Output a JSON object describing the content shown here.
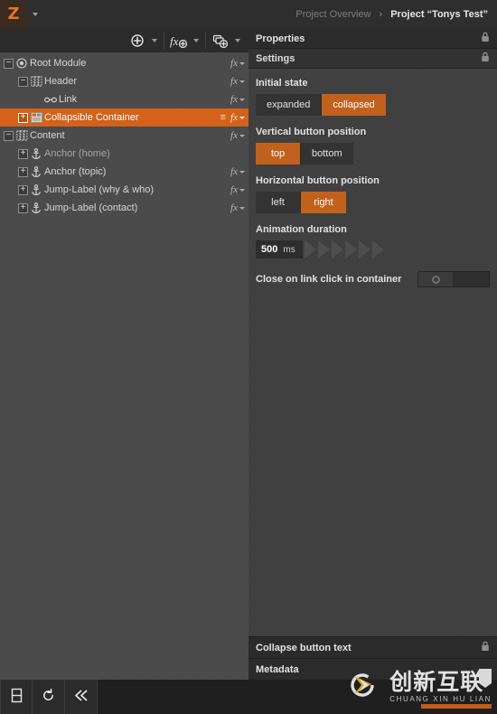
{
  "app": {
    "logo_glyph": "Z",
    "logo_name": "app-logo"
  },
  "breadcrumb": {
    "parent": "Project Overview",
    "separator": "›",
    "current": "Project “Tonys Test”"
  },
  "tree_toolbar": {
    "buttons": [
      {
        "name": "add-element-button",
        "glyph": "⊕",
        "caret": true
      },
      {
        "name": "add-function-button",
        "glyph": "fx",
        "caret": true
      },
      {
        "name": "add-module-button",
        "glyph": "⧉",
        "caret": true
      }
    ]
  },
  "tree": {
    "rows": [
      {
        "label": "Root Module",
        "indent": 0,
        "expander": "−",
        "icon": "target-icon",
        "selected": false,
        "dim": false,
        "fx": true,
        "hamburger": false
      },
      {
        "label": "Header",
        "indent": 1,
        "expander": "−",
        "icon": "container-icon",
        "selected": false,
        "dim": false,
        "fx": true,
        "hamburger": false
      },
      {
        "label": "Link",
        "indent": 2,
        "expander": "",
        "icon": "link-icon",
        "selected": false,
        "dim": false,
        "fx": true,
        "hamburger": false
      },
      {
        "label": "Collapsible Container",
        "indent": 1,
        "expander": "+",
        "icon": "module-icon",
        "selected": true,
        "dim": false,
        "fx": true,
        "hamburger": true
      },
      {
        "label": "Content",
        "indent": 0,
        "expander": "−",
        "icon": "container-icon",
        "selected": false,
        "dim": false,
        "fx": true,
        "hamburger": false
      },
      {
        "label": "Anchor (home)",
        "indent": 1,
        "expander": "+",
        "icon": "anchor-icon",
        "selected": false,
        "dim": true,
        "fx": false,
        "hamburger": false
      },
      {
        "label": "Anchor (topic)",
        "indent": 1,
        "expander": "+",
        "icon": "anchor-icon",
        "selected": false,
        "dim": false,
        "fx": true,
        "hamburger": false
      },
      {
        "label": "Jump-Label (why & who)",
        "indent": 1,
        "expander": "+",
        "icon": "anchor-icon",
        "selected": false,
        "dim": false,
        "fx": true,
        "hamburger": false
      },
      {
        "label": "Jump-Label (contact)",
        "indent": 1,
        "expander": "+",
        "icon": "anchor-icon",
        "selected": false,
        "dim": false,
        "fx": true,
        "hamburger": false
      }
    ],
    "fx_label": "fx",
    "hamburger_glyph": "≡"
  },
  "properties": {
    "header": "Properties",
    "settings_header": "Settings",
    "initial_state": {
      "label": "Initial state",
      "options": [
        "expanded",
        "collapsed"
      ],
      "selected": "collapsed"
    },
    "vertical_position": {
      "label": "Vertical button position",
      "options": [
        "top",
        "bottom"
      ],
      "selected": "top"
    },
    "horizontal_position": {
      "label": "Horizontal button position",
      "options": [
        "left",
        "right"
      ],
      "selected": "right"
    },
    "animation_duration": {
      "label": "Animation duration",
      "value": "500",
      "unit": "ms"
    },
    "close_on_link_click": {
      "label": "Close on link click in container",
      "state": "off"
    },
    "collapse_button_text": "Collapse button text",
    "metadata": "Metadata"
  },
  "bottom_bar": {
    "buttons": [
      {
        "name": "layout-panel-icon"
      },
      {
        "name": "refresh-icon"
      },
      {
        "name": "rewind-icon"
      }
    ]
  },
  "watermark": {
    "chinese": "创新互联",
    "pinyin": "CHUANG XIN HU LIAN"
  },
  "colors": {
    "accent": "#d4621a",
    "accent_button": "#c2611c",
    "panel": "#3f3f3f",
    "tree_panel": "#4a4a4a",
    "chrome": "#2b2b2b"
  }
}
